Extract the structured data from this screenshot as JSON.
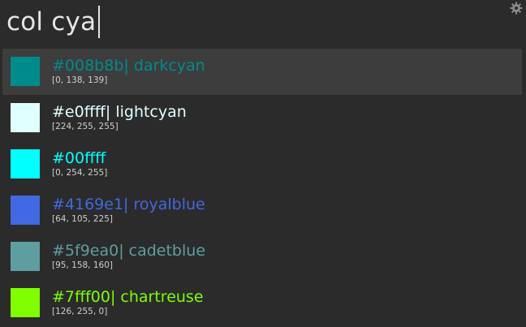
{
  "query": {
    "value": "col cya"
  },
  "settings": {
    "icon": "gear-icon"
  },
  "results": [
    {
      "title": "#008b8b| darkcyan",
      "subtitle": "[0, 138, 139]",
      "swatch": "#008b8b",
      "text_color": "#008b8b",
      "selected": true
    },
    {
      "title": "#e0ffff| lightcyan",
      "subtitle": "[224, 255, 255]",
      "swatch": "#e0ffff",
      "text_color": "#e0ffff",
      "selected": false
    },
    {
      "title": "#00ffff",
      "subtitle": "[0, 254, 255]",
      "swatch": "#00ffff",
      "text_color": "#00ffff",
      "selected": false
    },
    {
      "title": "#4169e1| royalblue",
      "subtitle": "[64, 105, 225]",
      "swatch": "#4169e1",
      "text_color": "#4169e1",
      "selected": false
    },
    {
      "title": "#5f9ea0| cadetblue",
      "subtitle": "[95, 158, 160]",
      "swatch": "#5f9ea0",
      "text_color": "#5f9ea0",
      "selected": false
    },
    {
      "title": "#7fff00| chartreuse",
      "subtitle": "[126, 255, 0]",
      "swatch": "#7fff00",
      "text_color": "#7fff00",
      "selected": false
    }
  ]
}
